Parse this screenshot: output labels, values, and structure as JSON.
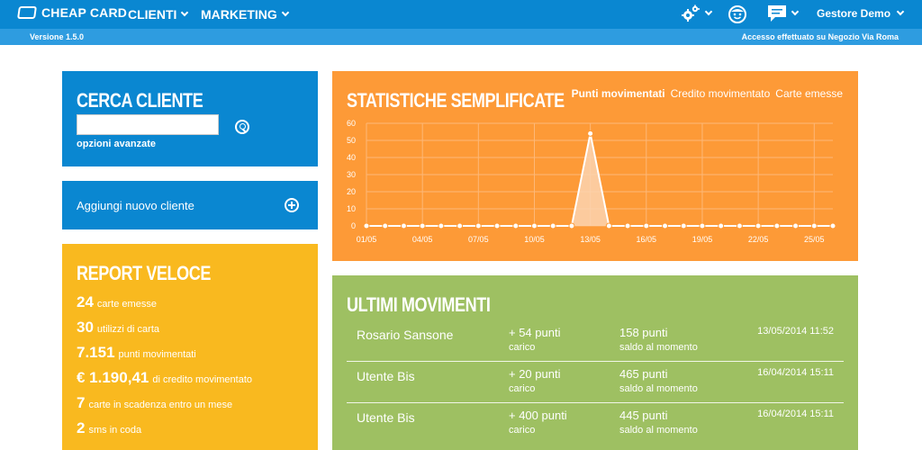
{
  "app": {
    "brand": "CHEAP CARD",
    "nav": [
      "CLIENTI",
      "MARKETING"
    ],
    "user": "Gestore Demo"
  },
  "subbar": {
    "version": "Versione 1.5.0",
    "login": "Accesso effettuato su Negozio Via Roma"
  },
  "search": {
    "title": "CERCA CLIENTE",
    "value": "",
    "advanced": "opzioni avanzate"
  },
  "add": {
    "label": "Aggiungi nuovo cliente"
  },
  "report": {
    "title": "REPORT VELOCE",
    "items": [
      {
        "num": "24",
        "text": "carte emesse"
      },
      {
        "num": "30",
        "text": "utilizzi di carta"
      },
      {
        "num": "7.151",
        "text": "punti movimentati"
      },
      {
        "num": "€ 1.190,41",
        "text": "di credito movimentato"
      },
      {
        "num": "7",
        "text": "carte in scadenza entro un mese"
      },
      {
        "num": "2",
        "text": "sms in coda"
      }
    ]
  },
  "stats": {
    "title": "STATISTICHE SEMPLIFICATE",
    "tabs": [
      {
        "label": "Punti movimentati",
        "active": true
      },
      {
        "label": "Credito movimentato",
        "active": false
      },
      {
        "label": "Carte emesse",
        "active": false
      }
    ]
  },
  "chart_data": {
    "type": "area",
    "x": [
      "01/05",
      "02/05",
      "03/05",
      "04/05",
      "05/05",
      "06/05",
      "07/05",
      "08/05",
      "09/05",
      "10/05",
      "11/05",
      "12/05",
      "13/05",
      "14/05",
      "15/05",
      "16/05",
      "17/05",
      "18/05",
      "19/05",
      "20/05",
      "21/05",
      "22/05",
      "23/05",
      "24/05",
      "25/05",
      "26/05"
    ],
    "xticks": [
      "01/05",
      "04/05",
      "07/05",
      "10/05",
      "13/05",
      "16/05",
      "19/05",
      "22/05",
      "25/05"
    ],
    "values": [
      0,
      0,
      0,
      0,
      0,
      0,
      0,
      0,
      0,
      0,
      0,
      0,
      54,
      0,
      0,
      0,
      0,
      0,
      0,
      0,
      0,
      0,
      0,
      0,
      0,
      0
    ],
    "yticks": [
      0,
      10,
      20,
      30,
      40,
      50,
      60
    ],
    "ylim": [
      0,
      60
    ],
    "grid": true,
    "colors": {
      "line": "#ffffff",
      "fill": "#fcd3b0",
      "grid": "#fdb878"
    }
  },
  "movements": {
    "title": "ULTIMI MOVIMENTI",
    "rows": [
      {
        "name": "Rosario Sansone",
        "points": "+ 54 punti",
        "points_label": "carico",
        "balance": "158 punti",
        "balance_label": "saldo al momento",
        "date": "13/05/2014 11:52"
      },
      {
        "name": "Utente Bis",
        "points": "+ 20 punti",
        "points_label": "carico",
        "balance": "465 punti",
        "balance_label": "saldo al momento",
        "date": "16/04/2014 15:11"
      },
      {
        "name": "Utente Bis",
        "points": "+ 400 punti",
        "points_label": "carico",
        "balance": "445 punti",
        "balance_label": "saldo al momento",
        "date": "16/04/2014 15:11"
      }
    ]
  },
  "colors": {
    "blue": "#0a87d1",
    "orange": "#fd9a37",
    "yellow": "#f9b91f",
    "green": "#9ec062"
  }
}
